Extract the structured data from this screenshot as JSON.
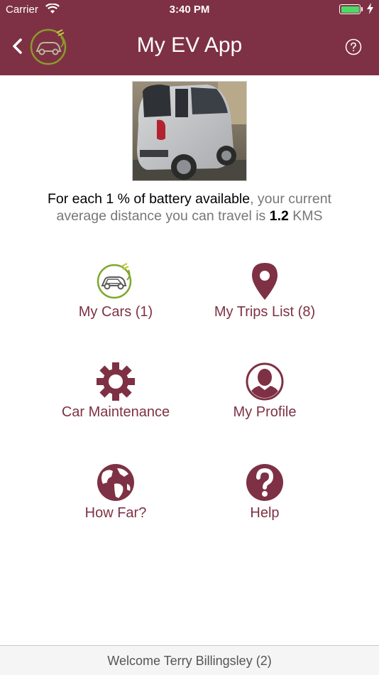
{
  "status_bar": {
    "carrier": "Carrier",
    "time": "3:40 PM",
    "battery_level": 1.0,
    "battery_color": "#4cd964"
  },
  "header": {
    "title": "My EV App",
    "background_color": "#7e3144",
    "back_icon": "chevron-left-icon",
    "help_icon": "question-circle-icon"
  },
  "info": {
    "part1": "For each 1 % of battery available",
    "part2": ", your current average distance you can travel is ",
    "distance": "1.2",
    "unit": " KMS"
  },
  "menu": {
    "my_cars": {
      "label": "My Cars (1)",
      "icon": "ev-car-icon"
    },
    "my_trips": {
      "label": "My Trips List (8)",
      "icon": "map-pin-icon"
    },
    "car_maintenance": {
      "label": "Car Maintenance",
      "icon": "gear-icon"
    },
    "my_profile": {
      "label": "My Profile",
      "icon": "user-silhouette-icon"
    },
    "how_far": {
      "label": "How Far?",
      "icon": "globe-icon"
    },
    "help": {
      "label": "Help",
      "icon": "question-icon"
    }
  },
  "accent_color": "#7e3144",
  "footer": {
    "welcome": "Welcome Terry Billingsley (2)"
  }
}
